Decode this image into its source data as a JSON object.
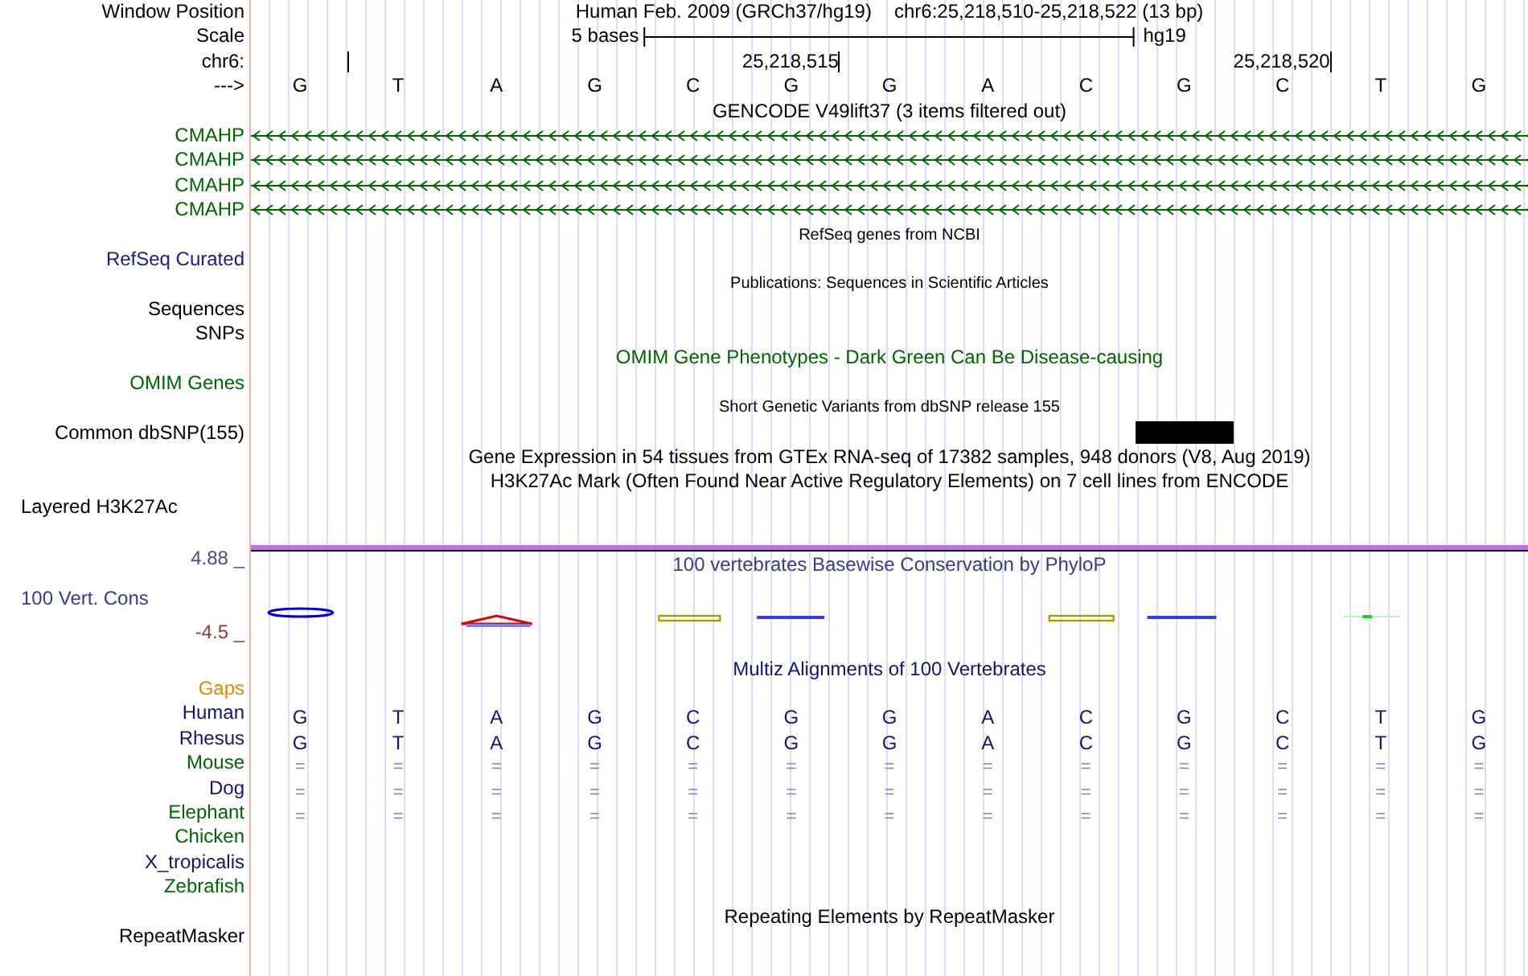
{
  "header": {
    "label": "Window Position",
    "assembly": "Human Feb. 2009 (GRCh37/hg19)",
    "position": "chr6:25,218,510-25,218,522 (13 bp)"
  },
  "scale": {
    "label": "Scale",
    "length": "5 bases",
    "assembly": "hg19"
  },
  "ruler": {
    "label": "chr6:"
  },
  "bases": {
    "label": "--->",
    "items": [
      {
        "base": "G",
        "tick": true
      },
      {
        "base": "T",
        "tick": false
      },
      {
        "base": "A",
        "tick": false
      },
      {
        "base": "G",
        "tick": false
      },
      {
        "base": "C",
        "tick": false
      },
      {
        "base": "G",
        "tick": true,
        "tick_label": "25,218,515"
      },
      {
        "base": "G",
        "tick": false
      },
      {
        "base": "A",
        "tick": false
      },
      {
        "base": "C",
        "tick": false
      },
      {
        "base": "G",
        "tick": false
      },
      {
        "base": "C",
        "tick": true,
        "tick_label": "25,218,520"
      },
      {
        "base": "T",
        "tick": false
      },
      {
        "base": "G",
        "tick": false
      }
    ]
  },
  "tracks": [
    {
      "kind": "title",
      "text": "GENCODE V49lift37 (3 items filtered out)",
      "color": "#000000"
    },
    {
      "kind": "gene",
      "label": "CMAHP",
      "color": "#006400"
    },
    {
      "kind": "gene",
      "label": "CMAHP",
      "color": "#006400"
    },
    {
      "kind": "gene",
      "label": "CMAHP",
      "color": "#006400"
    },
    {
      "kind": "gene",
      "label": "CMAHP",
      "color": "#006400"
    },
    {
      "kind": "note",
      "text": "RefSeq genes from NCBI",
      "color": "#000000"
    },
    {
      "kind": "label",
      "label": "RefSeq Curated",
      "color": "#1a1a8c"
    },
    {
      "kind": "note",
      "text": "Publications: Sequences in Scientific Articles",
      "color": "#000000"
    },
    {
      "kind": "label",
      "label": "Sequences",
      "color": "#000000"
    },
    {
      "kind": "label",
      "label": "SNPs",
      "color": "#000000"
    },
    {
      "kind": "title",
      "text": "OMIM Gene Phenotypes - Dark Green Can Be Disease-causing",
      "color": "#006400"
    },
    {
      "kind": "label",
      "label": "OMIM Genes",
      "color": "#006400"
    },
    {
      "kind": "note",
      "text": "Short Genetic Variants from dbSNP release 155",
      "color": "#000000"
    },
    {
      "kind": "snp",
      "label": "Common dbSNP(155)",
      "hits": [
        false,
        false,
        false,
        false,
        false,
        false,
        false,
        false,
        false,
        true,
        false,
        false,
        false
      ]
    },
    {
      "kind": "title",
      "text": "Gene Expression in 54 tissues from GTEx RNA-seq of 17382 samples, 948 donors (V8, Aug 2019)",
      "color": "#000000"
    },
    {
      "kind": "title",
      "text": "H3K27Ac Mark (Often Found Near Active Regulatory Elements) on 7 cell lines from ENCODE",
      "color": "#000000"
    },
    {
      "kind": "layered",
      "label": "Layered H3K27Ac"
    },
    {
      "kind": "conservation",
      "title": "100 vertebrates Basewise Conservation by PhyloP",
      "label": "100 Vert. Cons",
      "max_label": "4.88 _",
      "min_label": "-4.5 _"
    },
    {
      "kind": "title",
      "text": "Multiz Alignments of 100 Vertebrates",
      "color": "#14146e"
    },
    {
      "kind": "label",
      "label": "Gaps",
      "color": "#e08a00"
    },
    {
      "kind": "species",
      "label": "Human",
      "color": "#14146e",
      "identical": false,
      "bases": [
        "G",
        "T",
        "A",
        "G",
        "C",
        "G",
        "G",
        "A",
        "C",
        "G",
        "C",
        "T",
        "G"
      ]
    },
    {
      "kind": "species",
      "label": "Rhesus",
      "color": "#14146e",
      "identical": false,
      "bases": [
        "G",
        "T",
        "A",
        "G",
        "C",
        "G",
        "G",
        "A",
        "C",
        "G",
        "C",
        "T",
        "G"
      ]
    },
    {
      "kind": "species",
      "label": "Mouse",
      "color": "#006400",
      "identical": true,
      "bases": [
        "=",
        "=",
        "=",
        "=",
        "=",
        "=",
        "=",
        "=",
        "=",
        "=",
        "=",
        "=",
        "="
      ]
    },
    {
      "kind": "species",
      "label": "Dog",
      "color": "#14146e",
      "identical": true,
      "bases": [
        "=",
        "=",
        "=",
        "=",
        "=",
        "=",
        "=",
        "=",
        "=",
        "=",
        "=",
        "=",
        "="
      ]
    },
    {
      "kind": "species",
      "label": "Elephant",
      "color": "#006400",
      "identical": true,
      "bases": [
        "=",
        "=",
        "=",
        "=",
        "=",
        "=",
        "=",
        "=",
        "=",
        "=",
        "=",
        "=",
        "="
      ]
    },
    {
      "kind": "species",
      "label": "Chicken",
      "color": "#006400"
    },
    {
      "kind": "species",
      "label": "X_tropicalis",
      "color": "#14146e"
    },
    {
      "kind": "species",
      "label": "Zebrafish",
      "color": "#006400"
    },
    {
      "kind": "title",
      "text": "Repeating Elements by RepeatMasker",
      "color": "#000000"
    },
    {
      "kind": "label",
      "label": "RepeatMasker",
      "color": "#000000"
    }
  ]
}
